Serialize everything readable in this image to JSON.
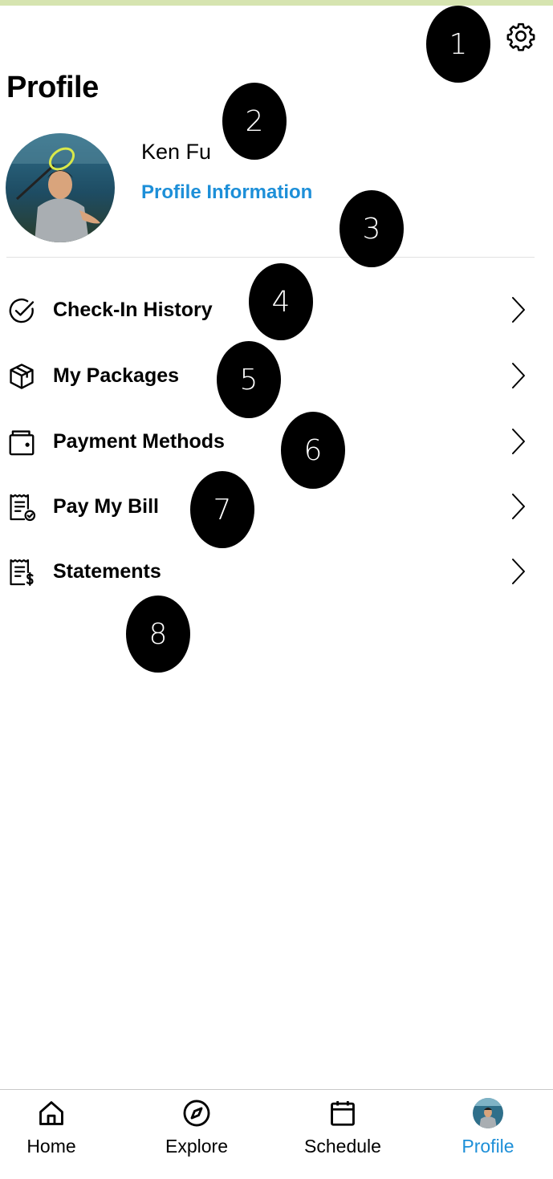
{
  "header": {
    "title": "Profile",
    "settings_icon": "gear-icon"
  },
  "user": {
    "name": "Ken Fu",
    "profile_link": "Profile Information",
    "avatar": "user-avatar-photo"
  },
  "menu": {
    "items": [
      {
        "label": "Check-In History",
        "icon": "check-circle-icon"
      },
      {
        "label": "My Packages",
        "icon": "package-box-icon"
      },
      {
        "label": "Payment Methods",
        "icon": "wallet-icon"
      },
      {
        "label": "Pay My Bill",
        "icon": "receipt-check-icon"
      },
      {
        "label": "Statements",
        "icon": "receipt-dollar-icon"
      }
    ]
  },
  "tabbar": {
    "tabs": [
      {
        "label": "Home",
        "icon": "home-icon",
        "active": false
      },
      {
        "label": "Explore",
        "icon": "compass-icon",
        "active": false
      },
      {
        "label": "Schedule",
        "icon": "calendar-icon",
        "active": false
      },
      {
        "label": "Profile",
        "icon": "avatar-icon",
        "active": true
      }
    ]
  },
  "annotations": {
    "markers": [
      "1",
      "2",
      "3",
      "4",
      "5",
      "6",
      "7",
      "8"
    ]
  },
  "colors": {
    "accent": "#1d8fd8",
    "top_strip": "#d6e4b0",
    "marker": "#000000"
  }
}
